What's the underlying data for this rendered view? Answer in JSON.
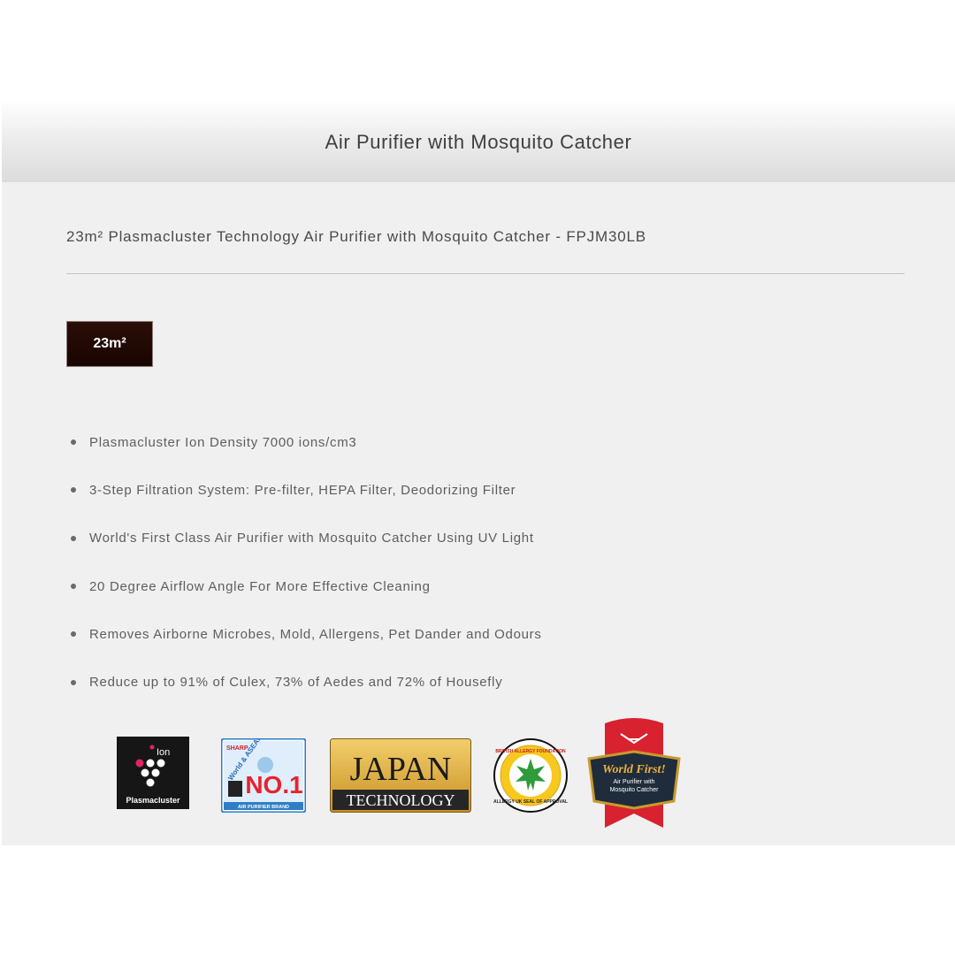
{
  "header": {
    "title": "Air Purifier with Mosquito Catcher"
  },
  "product": {
    "subtitle": "23m² Plasmacluster Technology Air Purifier with Mosquito Catcher - FPJM30LB",
    "area_badge": "23m²"
  },
  "features": [
    "Plasmacluster Ion Density 7000 ions/cm3",
    "3-Step Filtration System: Pre-filter, HEPA Filter, Deodorizing Filter",
    "World's First Class Air Purifier with Mosquito Catcher Using UV Light",
    "20 Degree Airflow Angle For More Effective Cleaning",
    "Removes Airborne Microbes, Mold, Allergens, Pet Dander and Odours",
    "Reduce up to 91% of Culex, 73% of Aedes and 72%  of Housefly"
  ],
  "logos": {
    "plasmacluster": {
      "label": "Plasmacluster",
      "ion_text": "Ion",
      "icon": "plasmacluster-logo"
    },
    "number_one": {
      "brand": "SHARP",
      "arc_text": "World & ASEAN's",
      "rank": "NO.1",
      "caption": "AIR PURIFIER BRAND",
      "icon": "number-one-badge"
    },
    "japan_tech": {
      "line1": "JAPAN",
      "line2": "TECHNOLOGY",
      "icon": "japan-technology-badge"
    },
    "allergy_seal": {
      "top_text": "BRITISH ALLERGY FOUNDATION",
      "bottom_text": "ALLERGY UK SEAL OF APPROVAL",
      "icon": "allergy-seal-icon"
    },
    "world_first": {
      "title": "World First!",
      "line1": "Air Purifier with",
      "line2": "Mosquito Catcher",
      "icon": "world-first-ribbon"
    }
  },
  "colors": {
    "panel_bg": "#f0f0f0",
    "badge_bg": "#1e0804",
    "ribbon_red": "#d8222f",
    "gold": "#d9a53a",
    "leaf_green": "#2f9b3a"
  }
}
